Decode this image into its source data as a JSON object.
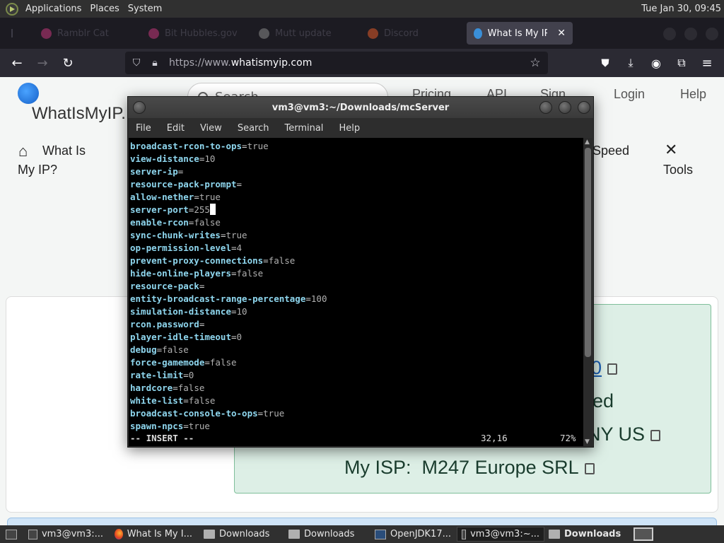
{
  "top_panel": {
    "menus": [
      "Applications",
      "Places",
      "System"
    ],
    "clock": "Tue Jan 30, 09:45"
  },
  "browser": {
    "tabs": [
      {
        "label": "Ramblr Cat",
        "active": false
      },
      {
        "label": "Bit Hubbles.gov",
        "active": false
      },
      {
        "label": "Mutt update",
        "active": false
      },
      {
        "label": "Discord",
        "active": false
      },
      {
        "label": "What Is My IP? D",
        "active": true
      }
    ],
    "url_prefix": "https://www.",
    "url_domain": "whatismyip.com"
  },
  "site": {
    "name": "WhatIsMyIP.",
    "search_placeholder": "Search",
    "topnav": [
      "Pricing",
      "API",
      "Sign",
      "Login",
      "Help"
    ],
    "nav_home_line1": "What Is",
    "nav_home_line2": "My IP?",
    "nav_speed": "Speed",
    "nav_tools": "Tools",
    "ip_fragment": "0",
    "status_fragment": "ed",
    "location_fragment": "NY US",
    "isp_label": "My ISP:",
    "isp_value": "M247 Europe SRL"
  },
  "terminal": {
    "title": "vm3@vm3:~/Downloads/mcServer",
    "menu": [
      "File",
      "Edit",
      "View",
      "Search",
      "Terminal",
      "Help"
    ],
    "lines": [
      {
        "key": "broadcast-rcon-to-ops",
        "value": "true"
      },
      {
        "key": "view-distance",
        "value": "10"
      },
      {
        "key": "server-ip",
        "value": ""
      },
      {
        "key": "resource-pack-prompt",
        "value": ""
      },
      {
        "key": "allow-nether",
        "value": "true"
      },
      {
        "key": "server-port",
        "value": "255"
      },
      {
        "key": "enable-rcon",
        "value": "false"
      },
      {
        "key": "sync-chunk-writes",
        "value": "true"
      },
      {
        "key": "op-permission-level",
        "value": "4"
      },
      {
        "key": "prevent-proxy-connections",
        "value": "false"
      },
      {
        "key": "hide-online-players",
        "value": "false"
      },
      {
        "key": "resource-pack",
        "value": ""
      },
      {
        "key": "entity-broadcast-range-percentage",
        "value": "100"
      },
      {
        "key": "simulation-distance",
        "value": "10"
      },
      {
        "key": "rcon.password",
        "value": ""
      },
      {
        "key": "player-idle-timeout",
        "value": "0"
      },
      {
        "key": "debug",
        "value": "false"
      },
      {
        "key": "force-gamemode",
        "value": "false"
      },
      {
        "key": "rate-limit",
        "value": "0"
      },
      {
        "key": "hardcore",
        "value": "false"
      },
      {
        "key": "white-list",
        "value": "false"
      },
      {
        "key": "broadcast-console-to-ops",
        "value": "true"
      },
      {
        "key": "spawn-npcs",
        "value": "true"
      }
    ],
    "mode": "-- INSERT --",
    "position": "32,16",
    "percent": "72%"
  },
  "taskbar": {
    "items": [
      {
        "label": "vm3@vm3:...",
        "icon": "terminal-icon"
      },
      {
        "label": "What Is My I...",
        "icon": "firefox-icon"
      },
      {
        "label": "Downloads",
        "icon": "folder-icon"
      },
      {
        "label": "Downloads",
        "icon": "folder-icon"
      },
      {
        "label": "OpenJDK17...",
        "icon": "java-icon"
      },
      {
        "label": "vm3@vm3:~...",
        "icon": "terminal-icon"
      },
      {
        "label": "Downloads",
        "icon": "folder-icon"
      }
    ]
  }
}
